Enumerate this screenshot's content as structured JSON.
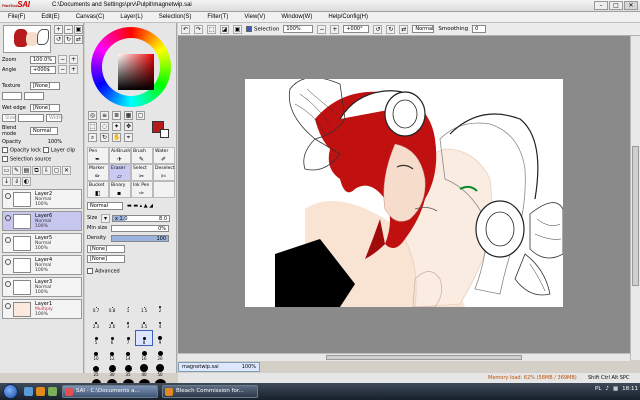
{
  "app": {
    "logo_top": "PaintTool",
    "logo_main": "SAI",
    "title": "C:\\Documents and Settings\\prv\\Pulpit\\magnetwip.sai",
    "window_controls": [
      "minimize-icon",
      "maximize-icon",
      "close-icon"
    ]
  },
  "menu": [
    "File(F)",
    "Edit(E)",
    "Canvas(C)",
    "Layer(L)",
    "Selection(S)",
    "Filter(T)",
    "View(V)",
    "Window(W)",
    "Help/Config(H)"
  ],
  "navigator": {
    "zoom_label": "Zoom",
    "zoom_value": "100.0%",
    "angle_label": "Angle",
    "angle_value": "+000$"
  },
  "layer_props": {
    "texture_label": "Texture",
    "texture_value": "[None]",
    "wet_edge_label": "Wet edge",
    "wet_edge_value": "[None]",
    "size_label": "Size",
    "width_label": "Width",
    "blend_label": "Blend mode",
    "blend_value": "Normal",
    "opacity_label": "Opacity",
    "opacity_value": "100%",
    "opacity_lock": "Opacity lock",
    "layer_clip": "Layer clip",
    "selection_source": "Selection source"
  },
  "layers": [
    {
      "name": "Layer2",
      "mode": "Normal",
      "opacity": "100%",
      "selected": false
    },
    {
      "name": "Layer6",
      "mode": "Normal",
      "opacity": "100%",
      "selected": true
    },
    {
      "name": "Layer5",
      "mode": "Normal",
      "opacity": "100%",
      "selected": false
    },
    {
      "name": "Layer4",
      "mode": "Normal",
      "opacity": "100%",
      "selected": false
    },
    {
      "name": "Layer3",
      "mode": "Normal",
      "opacity": "100%",
      "selected": false
    },
    {
      "name": "Layer1",
      "mode": "Multiply",
      "opacity": "100%",
      "selected": false
    }
  ],
  "colors": {
    "primary": "#b71c1c",
    "secondary": "#ffffff"
  },
  "brushes": [
    {
      "name": "Pen",
      "selected": false
    },
    {
      "name": "AirBrush",
      "selected": false
    },
    {
      "name": "Brush",
      "selected": false
    },
    {
      "name": "Water",
      "selected": false
    },
    {
      "name": "Marker",
      "selected": false
    },
    {
      "name": "Eraser",
      "selected": true
    },
    {
      "name": "Select",
      "selected": false
    },
    {
      "name": "Deselect",
      "selected": false
    },
    {
      "name": "Bucket",
      "selected": false
    },
    {
      "name": "Binary",
      "selected": false
    },
    {
      "name": "Ink Pen",
      "selected": false
    },
    {
      "name": "",
      "selected": false
    }
  ],
  "brush_settings": {
    "mode": "Normal",
    "size_label": "Size",
    "size_mult": "x 1.0",
    "size_value": "8.0",
    "size_fill": 0.22,
    "minsize_label": "Min size",
    "minsize_value": "0%",
    "minsize_fill": 0.0,
    "density_label": "Density",
    "density_value": "100",
    "density_fill": 1.0,
    "shape_value": "[None]",
    "texture_value": "[None]",
    "advanced_label": "Advanced"
  },
  "brush_sizes": [
    "0.7",
    "0.8",
    "1",
    "1.5",
    "2",
    "2.3",
    "2.6",
    "3",
    "3.5",
    "4",
    "5",
    "6",
    "7",
    "8",
    "9",
    "10",
    "12",
    "14",
    "16",
    "20",
    "25",
    "30",
    "35",
    "40",
    "50",
    "60",
    "70",
    "80",
    "100",
    "120"
  ],
  "selected_brush_size": "8",
  "canvas_toolbar": {
    "selection_label": "Selection",
    "zoom_value": "100%",
    "angle_value": "+000°",
    "mode_value": "Normal",
    "smoothing_label": "Smoothing",
    "smoothing_value": "0"
  },
  "file_tabs": [
    {
      "name": "magnetwip.sai",
      "zoom": "100%"
    }
  ],
  "status": {
    "memory": "Memory load: 62% (58MB / 369MB)",
    "keys": "Shift Ctrl Alt SPC",
    "sai_ver": "Any"
  },
  "taskbar": {
    "tasks": [
      {
        "label": "SAI - C:\\Documents a...",
        "active": true
      },
      {
        "label": "Bleach Commission for...",
        "active": false
      }
    ],
    "clock": "18:11",
    "lang": "PL"
  }
}
